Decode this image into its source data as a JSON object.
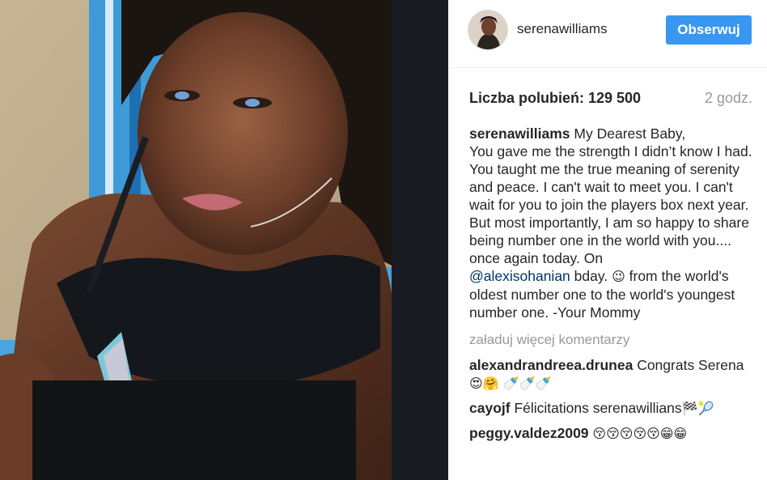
{
  "post": {
    "photo_alt": "",
    "author": "serenawilliams",
    "follow_label": "Obserwuj",
    "likes_label": "Liczba polubień: 129 500",
    "time_ago": "2 godz.",
    "caption_lead": "My Dearest Baby,\nYou gave me the strength I didn’t know I had. You taught me the true meaning of serenity and peace. I can't wait to meet you. I can't wait for you to join the players box next year. But most importantly, I am so happy to share being number one in the world with you.... once again today. On",
    "caption_mention": "@alexisohanian",
    "caption_mid": "bday.",
    "caption_emoji": "😉",
    "caption_tail": "from the world's oldest number one to the world's youngest number one. -Your Mommy",
    "load_more_label": "załaduj więcej komentarzy",
    "comments": [
      {
        "user": "alexandrandreea.drunea",
        "text": "Congrats Serena",
        "emoji": "😍🤗 🍼🍼🍼"
      },
      {
        "user": "cayojf",
        "text": "Félicitations serenawillians",
        "emoji": "🏁🎾"
      },
      {
        "user": "peggy.valdez2009",
        "text": "",
        "emoji": "😚😚😚😚😚😁😁"
      }
    ]
  },
  "colors": {
    "follow_button": "#3897f0",
    "mention": "#003569",
    "muted_text": "#999999"
  }
}
